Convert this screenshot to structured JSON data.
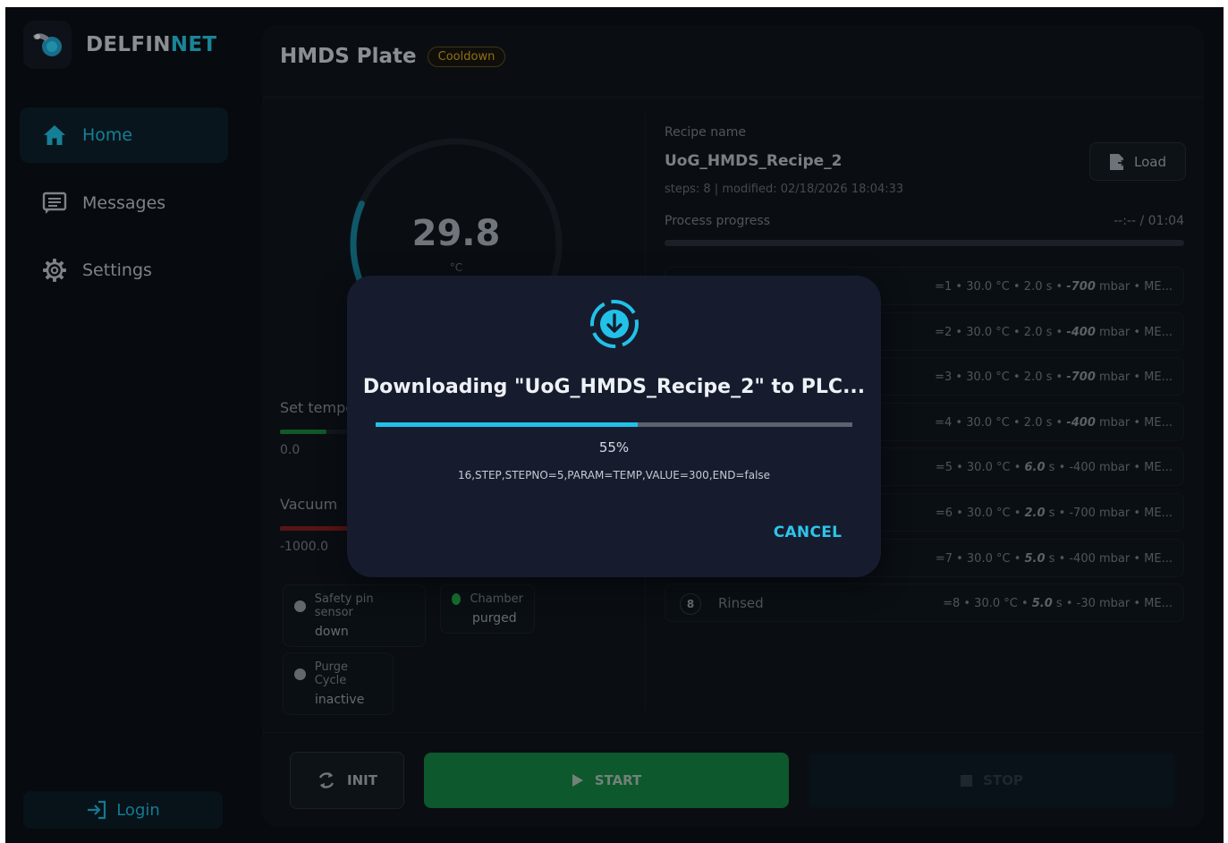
{
  "brand": {
    "name_main": "DELFIN",
    "name_accent": "NET",
    "accent_color": "#25b7d3"
  },
  "sidebar": {
    "items": [
      {
        "label": "Home",
        "icon": "home-icon",
        "active": true
      },
      {
        "label": "Messages",
        "icon": "messages-icon",
        "active": false
      },
      {
        "label": "Settings",
        "icon": "gear-icon",
        "active": false
      }
    ],
    "login_label": "Login"
  },
  "panel": {
    "title": "HMDS Plate",
    "status": "Cooldown",
    "status_color": "#c79a1d"
  },
  "gauge": {
    "value": "29.8",
    "unit": "°C",
    "fill_fraction": 0.12
  },
  "metrics": {
    "set_temp_label": "Set tempe",
    "set_temp_value": "0.0",
    "vacuum_label": "Vacuum",
    "vacuum_value": "-1000.0"
  },
  "indicators": [
    {
      "title": "Safety pin sensor",
      "state": "down",
      "color": "#8a8f95"
    },
    {
      "title": "Chamber",
      "state": "purged",
      "color": "#1f9a3f"
    },
    {
      "title": "Purge Cycle",
      "state": "inactive",
      "color": "#8a8f95"
    }
  ],
  "recipe": {
    "name_label": "Recipe name",
    "name": "UoG_HMDS_Recipe_2",
    "meta": "steps: 8 | modified: 02/18/2026 18:04:33",
    "load_label": "Load",
    "progress_label": "Process progress",
    "progress_time": "--:-- / 01:04"
  },
  "steps": [
    {
      "num": "",
      "name": "",
      "pre": "=1 • 30.0 °C • 2.0 s • ",
      "em": "-700",
      "post": " mbar • ME..."
    },
    {
      "num": "",
      "name": "",
      "pre": "=2 • 30.0 °C • 2.0 s • ",
      "em": "-400",
      "post": " mbar • ME..."
    },
    {
      "num": "",
      "name": "",
      "pre": "=3 • 30.0 °C • 2.0 s • ",
      "em": "-700",
      "post": " mbar • ME..."
    },
    {
      "num": "",
      "name": "",
      "pre": "=4 • 30.0 °C • 2.0 s • ",
      "em": "-400",
      "post": " mbar • ME..."
    },
    {
      "num": "",
      "name": "",
      "pre": "=5 • 30.0 °C • ",
      "em": "6.0",
      "post": " s • -400 mbar • ME..."
    },
    {
      "num": "",
      "name": "",
      "pre": "=6 • 30.0 °C • ",
      "em": "2.0",
      "post": " s • -700 mbar • ME..."
    },
    {
      "num": "",
      "name": "",
      "pre": "=7 • 30.0 °C • ",
      "em": "5.0",
      "post": " s • -400 mbar • ME..."
    },
    {
      "num": "8",
      "name": "Rinsed",
      "pre": "=8 • 30.0 °C • ",
      "em": "5.0",
      "post": " s • -30 mbar • ME..."
    }
  ],
  "controls": {
    "init_label": "INIT",
    "start_label": "START",
    "stop_label": "STOP",
    "start_color": "#137a3f"
  },
  "dialog": {
    "title": "Downloading \"UoG_HMDS_Recipe_2\" to PLC...",
    "progress_fraction": 0.55,
    "percent": "55%",
    "command": "16,STEP,STEPNO=5,PARAM=TEMP,VALUE=300,END=false",
    "cancel_label": "CANCEL",
    "accent_color": "#22c1e8"
  }
}
